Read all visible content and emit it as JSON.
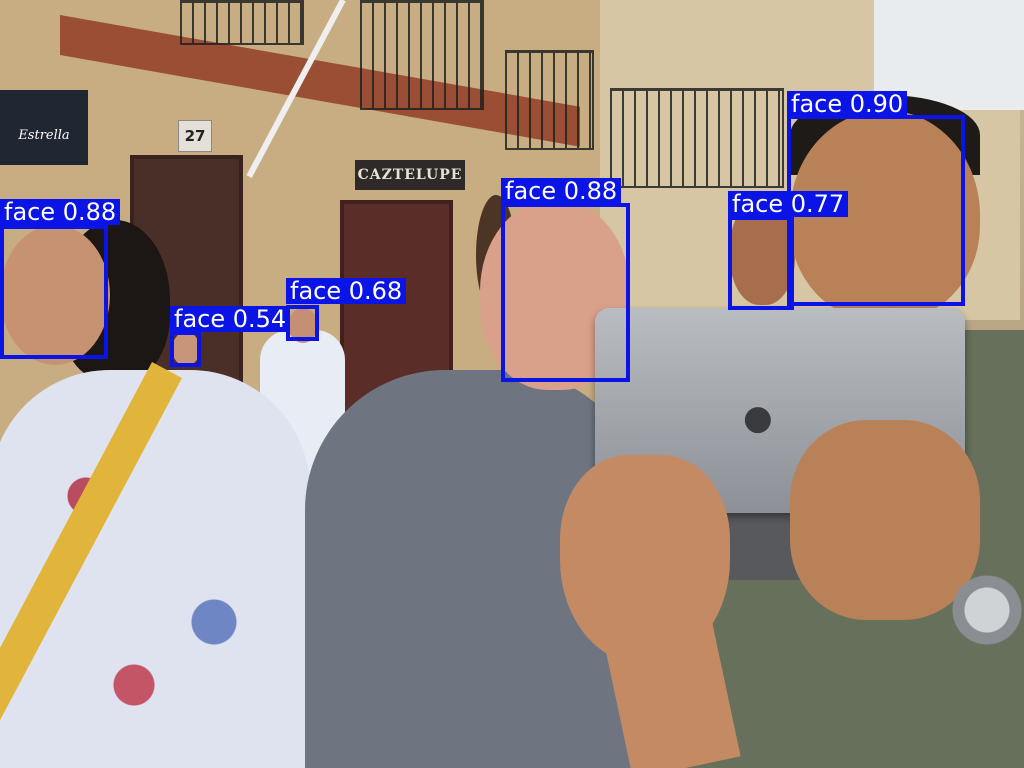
{
  "photo": {
    "street_signs": {
      "house_number": "27",
      "restaurant_sign": "CAZTELUPE",
      "beer_sign": "Estrella"
    }
  },
  "detections": [
    {
      "label": "face",
      "score": "0.88",
      "text": "face 0.88"
    },
    {
      "label": "face",
      "score": "0.54",
      "text": "face 0.54"
    },
    {
      "label": "face",
      "score": "0.68",
      "text": "face 0.68"
    },
    {
      "label": "face",
      "score": "0.88",
      "text": "face 0.88"
    },
    {
      "label": "face",
      "score": "0.77",
      "text": "face 0.77"
    },
    {
      "label": "face",
      "score": "0.90",
      "text": "face 0.90"
    }
  ],
  "box_color": "#0a14e6"
}
